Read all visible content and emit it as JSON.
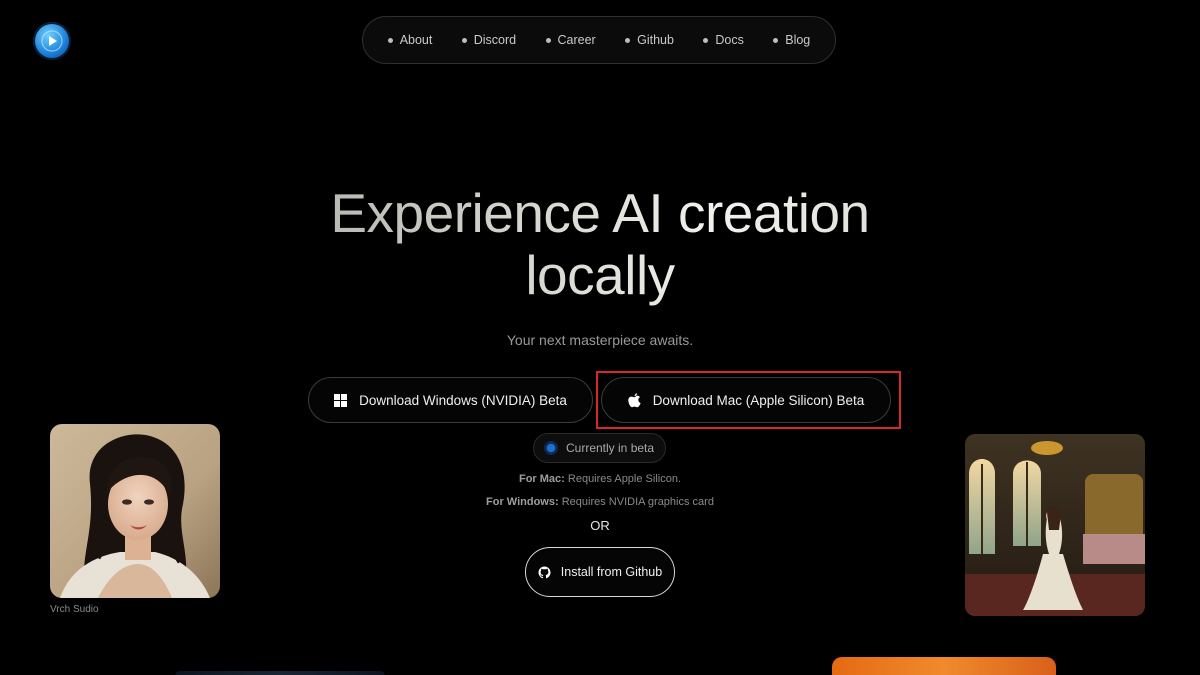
{
  "nav": {
    "items": [
      {
        "label": "About"
      },
      {
        "label": "Discord"
      },
      {
        "label": "Career"
      },
      {
        "label": "Github"
      },
      {
        "label": "Docs"
      },
      {
        "label": "Blog"
      }
    ]
  },
  "hero": {
    "title_line1": "Experience AI creation",
    "title_line2": "locally",
    "subtitle": "Your next masterpiece awaits."
  },
  "downloads": {
    "windows_label": "Download Windows (NVIDIA) Beta",
    "mac_label": "Download Mac (Apple Silicon) Beta",
    "beta_label": "Currently in beta",
    "mac_req_prefix": "For Mac:",
    "mac_req_text": " Requires Apple Silicon.",
    "win_req_prefix": "For Windows:",
    "win_req_text": " Requires NVIDIA graphics card",
    "or_label": "OR",
    "github_label": "Install from Github"
  },
  "gallery": {
    "portrait_caption": "Vrch Sudio"
  },
  "colors": {
    "background": "#000000",
    "highlight": "#d62828",
    "accent_blue": "#1f6fd1",
    "card_orange": "#f08a2c"
  },
  "icons": {
    "logo": "play-logo-icon",
    "windows": "windows-icon",
    "apple": "apple-icon",
    "github": "github-icon",
    "beta": "beta-status-icon"
  }
}
